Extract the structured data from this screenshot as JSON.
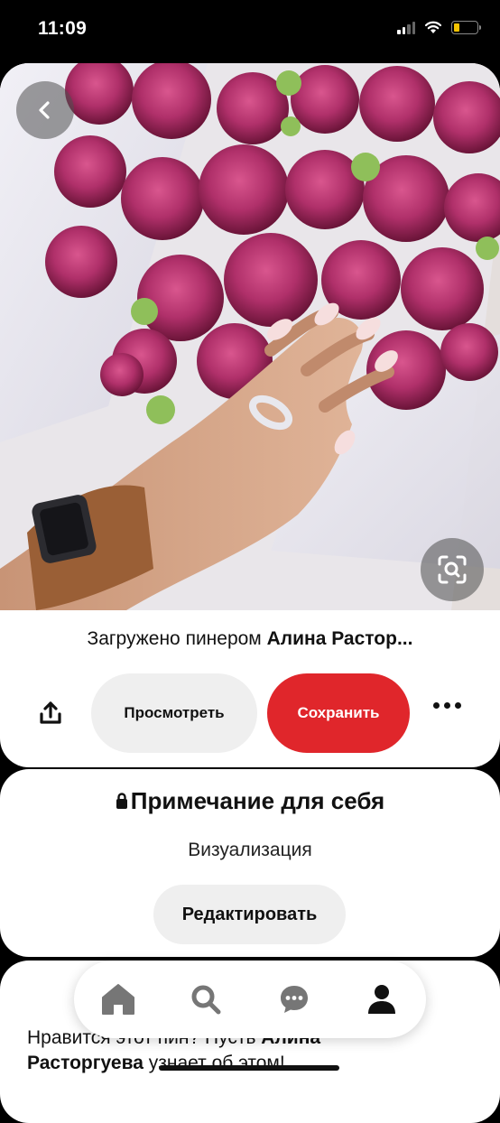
{
  "status_bar": {
    "time": "11:09"
  },
  "pin": {
    "uploaded_prefix": "Загружено пинером ",
    "uploaded_by": "Алина Растор..."
  },
  "actions": {
    "view_label": "Просмотреть",
    "save_label": "Сохранить"
  },
  "note": {
    "title": "Примечание для себя",
    "subtitle": "Визуализация",
    "edit_label": "Редактировать"
  },
  "likes": {
    "prefix": "Нравится этот пин? Пусть ",
    "name": "Алина Расторгуева",
    "suffix": " узнает об этом!"
  },
  "tabbar": {
    "items": [
      "home-icon",
      "search-icon",
      "chat-icon",
      "profile-icon"
    ]
  },
  "colors": {
    "save": "#e0262b",
    "button_gray": "#efefef"
  }
}
